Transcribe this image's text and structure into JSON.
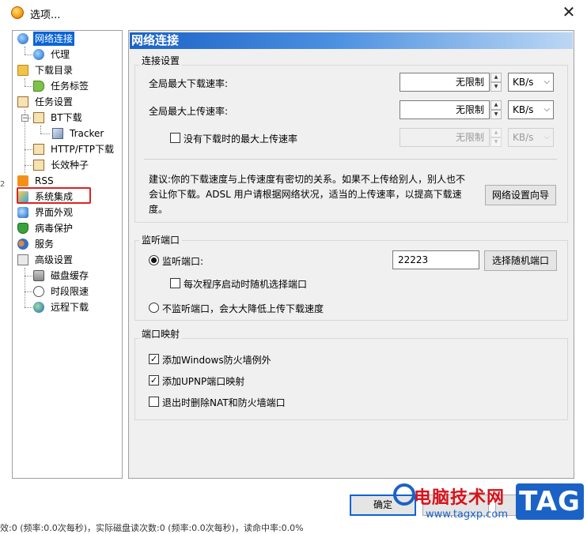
{
  "window": {
    "title": "选项..."
  },
  "tree": {
    "items": [
      {
        "label": "网络连接",
        "icon": "network-globe-icon"
      },
      {
        "label": "代理",
        "icon": "proxy-globe-icon"
      },
      {
        "label": "下载目录",
        "icon": "folder-icon"
      },
      {
        "label": "任务标签",
        "icon": "tag-icon"
      },
      {
        "label": "任务设置",
        "icon": "clipboard-icon"
      },
      {
        "label": "BT下载",
        "icon": "clipboard-icon"
      },
      {
        "label": "Tracker",
        "icon": "cube-icon"
      },
      {
        "label": "HTTP/FTP下载",
        "icon": "clipboard-icon"
      },
      {
        "label": "长效种子",
        "icon": "clipboard-icon"
      },
      {
        "label": "RSS",
        "icon": "rss-icon"
      },
      {
        "label": "系统集成",
        "icon": "integration-icon"
      },
      {
        "label": "界面外观",
        "icon": "palette-icon"
      },
      {
        "label": "病毒保护",
        "icon": "shield-icon"
      },
      {
        "label": "服务",
        "icon": "users-icon"
      },
      {
        "label": "高级设置",
        "icon": "advanced-icon"
      },
      {
        "label": "磁盘缓存",
        "icon": "disk-icon"
      },
      {
        "label": "时段限速",
        "icon": "clock-icon"
      },
      {
        "label": "远程下载",
        "icon": "remote-globe-icon"
      }
    ]
  },
  "panel": {
    "header": "网络连接",
    "connection": {
      "group_label": "连接设置",
      "download_label": "全局最大下载速率:",
      "download_value": "无限制",
      "upload_label": "全局最大上传速率:",
      "upload_value": "无限制",
      "no_download_label": "没有下载时的最大上传速率",
      "no_download_value": "无限制",
      "unit": "KB/s",
      "advice": "建议:你的下载速度与上传速度有密切的关系。如果不上传给别人，别人也不会让你下载。ADSL 用户请根据网络状况，适当的上传速率，以提高下载速度。",
      "wizard_button": "网络设置向导"
    },
    "listen": {
      "group_label": "监听端口",
      "listen_label": "监听端口:",
      "port_value": "22223",
      "random_button": "选择随机端口",
      "random_on_start_label": "每次程序启动时随机选择端口",
      "no_listen_label": "不监听端口，会大大降低上传下载速度"
    },
    "mapping": {
      "group_label": "端口映射",
      "firewall_label": "添加Windows防火墙例外",
      "upnp_label": "添加UPNP端口映射",
      "remove_nat_label": "退出时删除NAT和防火墙端口"
    }
  },
  "buttons": {
    "ok": "确定"
  },
  "status_bar": "效:0 (频率:0.0次每秒)，实际磁盘读次数:0 (频率:0.0次每秒)，读命中率:0.0%",
  "watermark": {
    "site_cn": "电脑技术网",
    "url": "www.tagxp.com",
    "tag": "TAG"
  },
  "colors": {
    "selection": "#0a64d8",
    "header_start": "#1b62c6",
    "highlight_box": "#e02020"
  }
}
